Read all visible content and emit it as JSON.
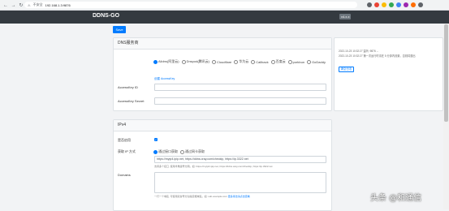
{
  "browser": {
    "nav_glyphs": "← → ↻",
    "security": "不安全",
    "url": "192.168.1.3:9876",
    "extension_colors": [
      "#5f6368",
      "#ea4335",
      "#fbbc05",
      "#34a853",
      "#4285f4",
      "#9c27b0",
      "#ff6d00",
      "#5f6368"
    ]
  },
  "header": {
    "brand": "DDNS-GO",
    "version": "v4.x.x"
  },
  "toolbar": {
    "save_label": "Save"
  },
  "dns": {
    "title": "DNS服务商",
    "providers": [
      {
        "label": "Alidns(阿里云)",
        "checked": true
      },
      {
        "label": "Dnspod(腾讯云)",
        "checked": false
      },
      {
        "label": "Cloudflare",
        "checked": false
      },
      {
        "label": "华为云",
        "checked": false
      },
      {
        "label": "Callback",
        "checked": false
      },
      {
        "label": "百度云",
        "checked": false
      },
      {
        "label": "porkbun",
        "checked": false
      },
      {
        "label": "GoDaddy",
        "checked": false
      }
    ],
    "help_link": "创建 AccessKey",
    "accesskey_id_label": "AccessKey ID",
    "accesskey_secret_label": "AccessKey Secret",
    "accesskey_id_value": "",
    "accesskey_secret_value": ""
  },
  "log": {
    "lines": [
      "2022-10-23 10:32:27 监听 :9876 ...",
      "2022-10-23 10:32:27 第一次运行时请在 5 分钟内设置，否则将退出"
    ],
    "clear_label": "清空日志"
  },
  "ipv4": {
    "title": "IPv4",
    "enabled_label": "是否启用",
    "enabled_mark": "✓",
    "method_label": "获取 IP 方式",
    "methods": [
      {
        "label": "通过接口获取",
        "checked": true
      },
      {
        "label": "通过网卡获取",
        "checked": false
      }
    ],
    "url_value": "https://myip4.ipip.net, https://ddns.oray.com/checkip, https://ip.3322.net",
    "url_hint": "支持多个接口, 使用半角逗号分隔。如:  https://myip4.ipip.net, https://ddns.oray.com/checkip, https://ip.3322.net",
    "domains_label": "Domains",
    "domains_hint_prefix": "一行一个域名, 可使用双冒号分割指定根域名。如:  sub.example.com ",
    "domains_hint_link": "更多用法请点击查看"
  },
  "watermark": "头条 @和通信"
}
